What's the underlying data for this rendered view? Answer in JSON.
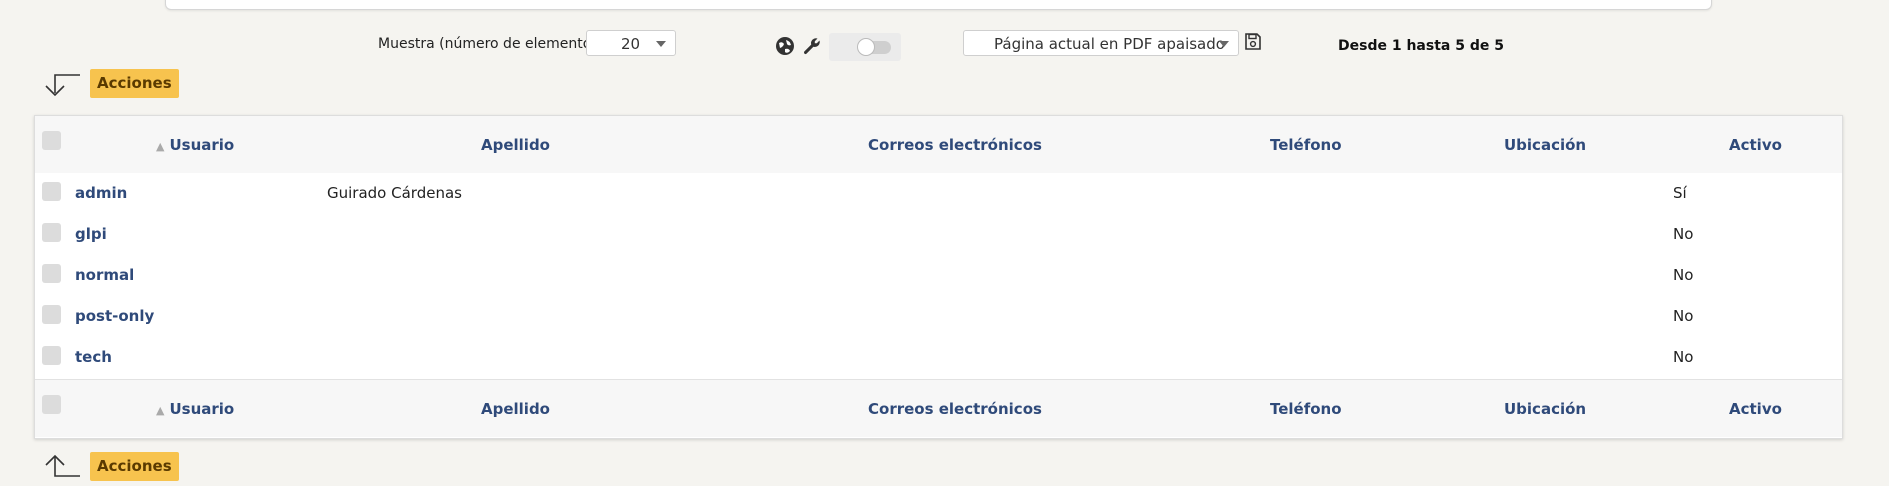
{
  "toolbar": {
    "display_label": "Muestra (número de elementos)",
    "display_count": "20",
    "export_option": "Página actual en PDF apaisado",
    "pagination": "Desde 1 hasta 5 de 5"
  },
  "actions": {
    "top_label": "Acciones",
    "bottom_label": "Acciones"
  },
  "table": {
    "columns": [
      "Usuario",
      "Apellido",
      "Correos electrónicos",
      "Teléfono",
      "Ubicación",
      "Activo"
    ],
    "sort_indicator": "▲",
    "rows": [
      {
        "usuario": "admin",
        "apellido": "Guirado Cárdenas",
        "correos": "",
        "telefono": "",
        "ubicacion": "",
        "activo": "Sí"
      },
      {
        "usuario": "glpi",
        "apellido": "",
        "correos": "",
        "telefono": "",
        "ubicacion": "",
        "activo": "No"
      },
      {
        "usuario": "normal",
        "apellido": "",
        "correos": "",
        "telefono": "",
        "ubicacion": "",
        "activo": "No"
      },
      {
        "usuario": "post-only",
        "apellido": "",
        "correos": "",
        "telefono": "",
        "ubicacion": "",
        "activo": "No"
      },
      {
        "usuario": "tech",
        "apellido": "",
        "correos": "",
        "telefono": "",
        "ubicacion": "",
        "activo": "No"
      }
    ]
  },
  "icons": {
    "global": "globe-icon",
    "config": "wrench-icon",
    "delete": "trash-icon",
    "save": "save-icon"
  },
  "colors": {
    "background": "#f5f4f0",
    "link": "#2f4a7a",
    "actions_button": "#f7c34e"
  }
}
